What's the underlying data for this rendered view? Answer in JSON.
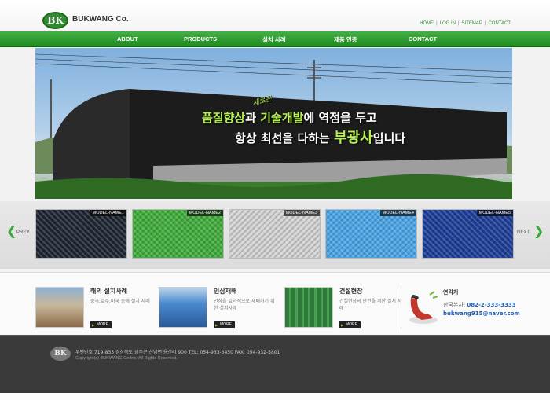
{
  "header": {
    "logo_badge": "BK",
    "logo_text": "BUKWANG Co.",
    "util_links": [
      "HOME",
      "LOG IN",
      "SITEMAP",
      "CONTACT"
    ]
  },
  "nav": {
    "items": [
      "ABOUT",
      "PRODUCTS",
      "설치 사례",
      "제품 인증",
      "CONTACT"
    ]
  },
  "hero": {
    "new_tag": "새로운",
    "line1_a": "품질향상",
    "line1_b": "과 ",
    "line1_c": "기술개발",
    "line1_d": "에 역점을 두고",
    "line2_a": "항상 최선을 다하는 ",
    "line2_b": "부광사",
    "line2_c": "입니다"
  },
  "products": {
    "prev_label": "PREV",
    "next_label": "NEXT",
    "items": [
      {
        "caption": "MODEL-NAME1",
        "color": "#1e2633"
      },
      {
        "caption": "MODEL-NAME2",
        "color": "#3fae3a"
      },
      {
        "caption": "MODEL-NAME3",
        "color": "#d4d4d4"
      },
      {
        "caption": "MODEL-NAME4",
        "color": "#4aa6e8"
      },
      {
        "caption": "MODEL-NAME5",
        "color": "#1c3e9a"
      }
    ]
  },
  "info": {
    "cards": [
      {
        "title": "해외 설치사례",
        "desc": "중국,호주,미국 등에 설치 사례",
        "more": "MORE"
      },
      {
        "title": "인삼재배",
        "desc": "인삼을 효과적으로 재배하기 위한 설치사례",
        "more": "MORE"
      },
      {
        "title": "건설현장",
        "desc": "건설현장의 안전을 위한 설치 사례",
        "more": "MORE"
      }
    ],
    "contact": {
      "title": "연락처",
      "phone_label": "한국본사: ",
      "phone": "082-2-333-3333",
      "email": "bukwang915@naver.com"
    }
  },
  "footer": {
    "logo": "BK",
    "address": "우편번호 719-833 경상북도 성주군 선남면 용신리 900   TEL: 054-933-3450   FAX: 054-932-5801",
    "copyright": "Copyright(c) BUKWANG Co.Inc. All Rights Reserved."
  },
  "colors": {
    "brand_green": "#2e8b2e",
    "nav_green": "#3aa83a",
    "highlight_green": "#b6f052",
    "footer_bg": "#3a3a3a"
  }
}
